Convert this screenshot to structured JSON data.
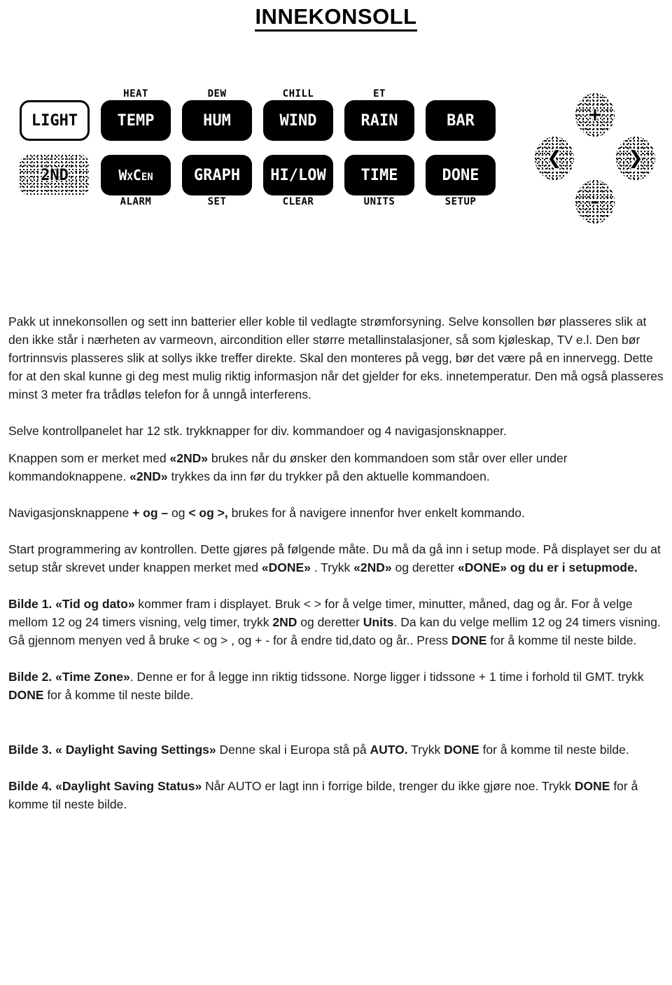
{
  "title": "INNEKONSOLL",
  "console": {
    "keys_row1": [
      {
        "top_label": "",
        "key": "LIGHT",
        "style": "outline"
      },
      {
        "top_label": "HEAT",
        "key": "TEMP",
        "style": "solid"
      },
      {
        "top_label": "DEW",
        "key": "HUM",
        "style": "solid"
      },
      {
        "top_label": "CHILL",
        "key": "WIND",
        "style": "solid"
      },
      {
        "top_label": "ET",
        "key": "RAIN",
        "style": "solid"
      },
      {
        "top_label": "",
        "key": "BAR",
        "style": "solid"
      }
    ],
    "keys_row2": [
      {
        "key": "2ND",
        "bottom_label": "",
        "style": "textured"
      },
      {
        "key": "WxCen",
        "bottom_label": "ALARM",
        "style": "solid"
      },
      {
        "key": "GRAPH",
        "bottom_label": "SET",
        "style": "solid"
      },
      {
        "key": "HI/LOW",
        "bottom_label": "CLEAR",
        "style": "solid"
      },
      {
        "key": "TIME",
        "bottom_label": "UNITS",
        "style": "solid"
      },
      {
        "key": "DONE",
        "bottom_label": "SETUP",
        "style": "solid"
      }
    ],
    "navpad": {
      "up": "+",
      "down": "–",
      "left": "❮",
      "right": "❯"
    }
  },
  "text": {
    "p1": "Pakk ut innekonsollen og sett inn batterier eller koble  til vedlagte strømforsyning. Selve konsollen bør plasseres slik at den ikke står i nærheten av varmeovn, aircondition eller større metallinstalasjoner,  så som kjøleskap, TV e.l. Den bør fortrinnsvis plasseres slik at sollys ikke treffer direkte. Skal den monteres på vegg, bør det være på en innervegg. Dette for at den skal kunne gi deg mest mulig riktig informasjon når det gjelder for eks. innetemperatur. Den må også plasseres minst 3 meter fra trådløs telefon for å unngå interferens.",
    "p2": " Selve kontrollpanelet har 12 stk. trykknapper  for div. kommandoer og 4 navigasjonsknapper.",
    "p3_a": "Knappen som er merket med ",
    "p3_b1": "«2ND»",
    "p3_c": " brukes når du ønsker den kommandoen som står over eller under kommandoknappene. ",
    "p3_b2": "«2ND»",
    "p3_d": " trykkes da inn før du trykker på den aktuelle kommandoen.",
    "p4_a": "Navigasjonsknappene  ",
    "p4_b1": "+ og –",
    "p4_c": "   og   ",
    "p4_b2": "< og >,",
    "p4_d": " brukes for å navigere innenfor hver enkelt kommando.",
    "p5_a": " Start programmering av kontrollen. Dette gjøres på følgende måte. Du må da gå inn i setup mode. På displayet ser du at setup står skrevet  under knappen merket med ",
    "p5_b1": "«DONE»",
    "p5_c": " .  Trykk ",
    "p5_b2": "«2ND»",
    "p5_d": " og deretter ",
    "p5_b3": "«DONE»  og du er i setupmode.",
    "b1_head": "Bilde 1.",
    "b1_q": "  «Tid og dato»",
    "b1_a": " kommer fram i displayet.  Bruk  <  > for å velge timer, minutter, måned, dag og år. For å velge mellom 12 og 24 timers visning, velg  timer, trykk  ",
    "b1_b1": "2ND",
    "b1_c": " og deretter ",
    "b1_b2": "Units",
    "b1_d": ". Da kan du velge mellim 12 og 24 timers visning. Gå gjennom menyen ved å bruke < og > , og +  - for å endre tid,dato og år.. Press  ",
    "b1_b3": "DONE",
    "b1_e": "  for å komme til neste bilde.",
    "b2_head": "Bilde 2.",
    "b2_q": " «Time Zone»",
    "b2_a": ". Denne er for å legge inn riktig  tidssone. Norge ligger i tidssone + 1 time i forhold til GMT.  trykk  ",
    "b2_b1": "DONE",
    "b2_b": "  for å komme til neste bilde.",
    "b3_head": "Bilde 3.",
    "b3_q": " « Daylight Saving Settings»",
    "b3_a": "  Denne skal i Europa stå på   ",
    "b3_b1": "AUTO.",
    "b3_b": " Trykk  ",
    "b3_b2": "DONE",
    "b3_c": " for å komme til neste bilde.",
    "b4_head": "Bilde 4.",
    "b4_q": " «Daylight Saving Status»",
    "b4_a": " Når AUTO er lagt inn i forrige bilde, trenger du ikke gjøre noe. Trykk  ",
    "b4_b1": "DONE",
    "b4_b": "  for å komme til neste bilde."
  }
}
